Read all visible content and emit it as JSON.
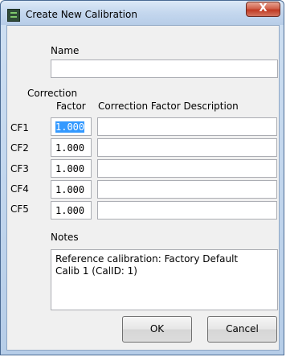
{
  "window": {
    "title": "Create New Calibration",
    "close_glyph": "X"
  },
  "name": {
    "label": "Name",
    "value": ""
  },
  "headers": {
    "correction_factor_line1": "Correction",
    "correction_factor_line2": "Factor",
    "description": "Correction Factor Description"
  },
  "factors": [
    {
      "label": "CF1",
      "value": "1.000",
      "description": "",
      "selected": true
    },
    {
      "label": "CF2",
      "value": "1.000",
      "description": ""
    },
    {
      "label": "CF3",
      "value": "1.000",
      "description": ""
    },
    {
      "label": "CF4",
      "value": "1.000",
      "description": ""
    },
    {
      "label": "CF5",
      "value": "1.000",
      "description": ""
    }
  ],
  "notes": {
    "label": "Notes",
    "value": "Reference calibration: Factory Default\nCalib 1 (CalID: 1)"
  },
  "buttons": {
    "ok": "OK",
    "cancel": "Cancel"
  },
  "colors": {
    "selection": "#3399ff",
    "close": "#c03a23"
  },
  "icons": {
    "app": "calibration-app-icon",
    "close": "close-icon"
  }
}
